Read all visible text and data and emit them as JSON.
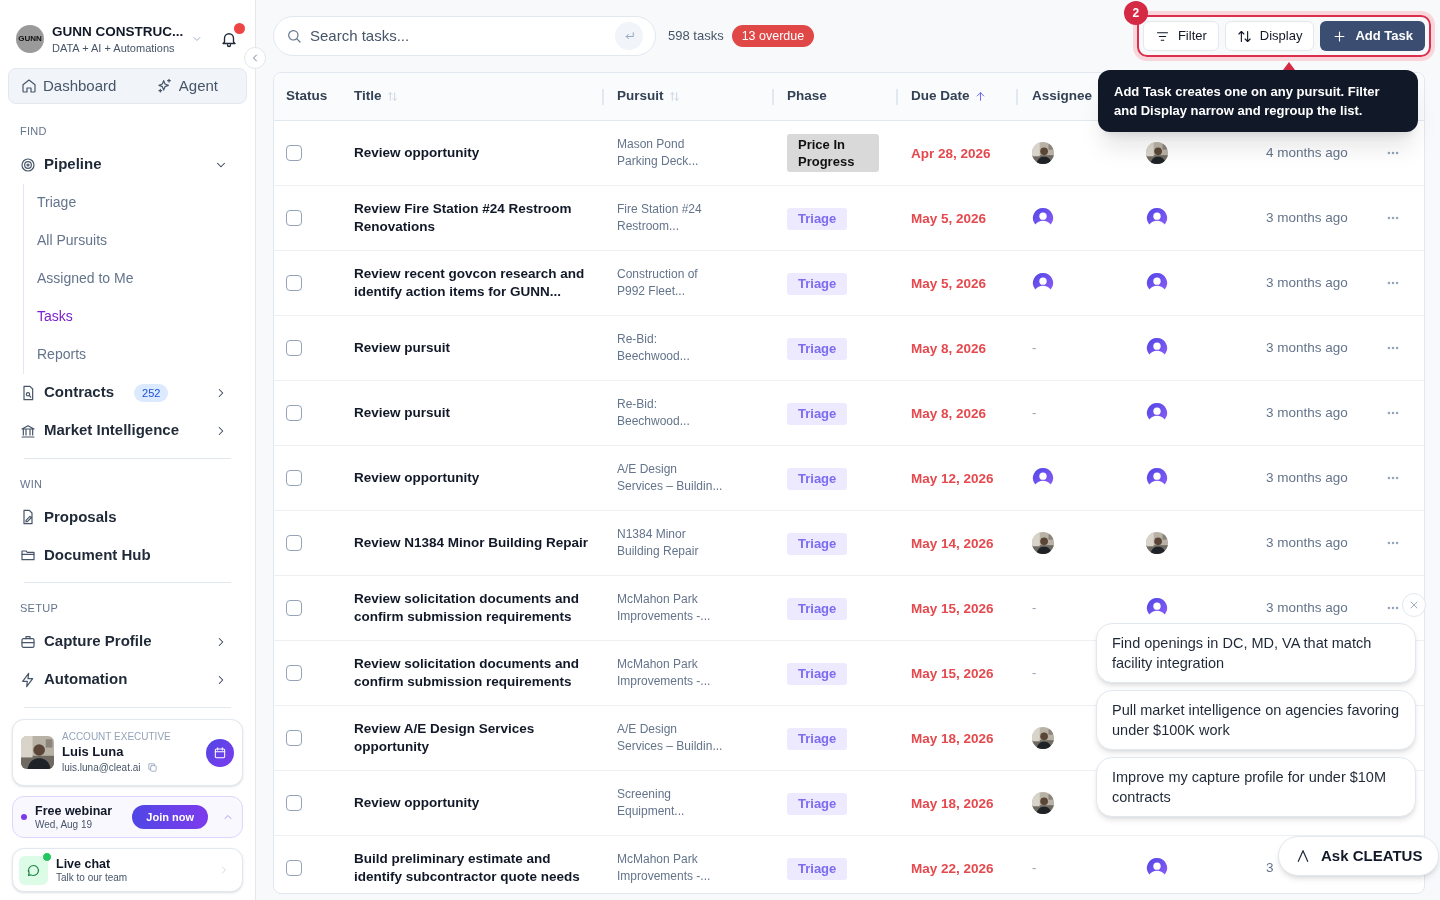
{
  "org": {
    "name": "GUNN CONSTRUC...",
    "subtitle": "DATA + AI + Automations",
    "logo": "GUNN",
    "has_notifications": true
  },
  "top_nav": [
    {
      "label": "Dashboard",
      "selected": false
    },
    {
      "label": "Agent",
      "selected": false
    }
  ],
  "sections": [
    {
      "heading": "FIND",
      "items": [
        {
          "label": "Pipeline",
          "expanded": true,
          "children": [
            {
              "label": "Triage",
              "selected": false
            },
            {
              "label": "All Pursuits",
              "selected": false
            },
            {
              "label": "Assigned to Me",
              "selected": false
            },
            {
              "label": "Tasks",
              "selected": true
            },
            {
              "label": "Reports",
              "selected": false
            }
          ]
        },
        {
          "label": "Contracts",
          "badge": "252",
          "expanded": false
        },
        {
          "label": "Market Intelligence",
          "expanded": false
        }
      ]
    },
    {
      "heading": "WIN",
      "items": [
        {
          "label": "Proposals"
        },
        {
          "label": "Document Hub"
        }
      ]
    },
    {
      "heading": "SETUP",
      "items": [
        {
          "label": "Capture Profile",
          "expanded": false
        },
        {
          "label": "Automation",
          "expanded": false
        }
      ]
    }
  ],
  "account": {
    "role": "ACCOUNT EXECUTIVE",
    "name": "Luis Luna",
    "email": "luis.luna@cleat.ai"
  },
  "webinar": {
    "title": "Free webinar",
    "date": "Wed, Aug 19",
    "button": "Join now"
  },
  "chat": {
    "title": "Live chat",
    "subtitle": "Talk to our team",
    "online": true
  },
  "search": {
    "placeholder": "Search tasks..."
  },
  "task_count": "598 tasks",
  "overdue": "13 overdue",
  "toolbar": {
    "step": "2",
    "buttons": [
      {
        "label": "Filter",
        "kind": "filter"
      },
      {
        "label": "Display",
        "kind": "display"
      },
      {
        "label": "Add Task",
        "kind": "add"
      }
    ]
  },
  "tooltip": "Add Task creates one on any pursuit. Filter and Display narrow and regroup the list.",
  "table": {
    "columns": [
      {
        "label": "Status"
      },
      {
        "label": "Title",
        "sortable": true
      },
      {
        "label": "Pursuit",
        "sortable": true
      },
      {
        "label": "Phase"
      },
      {
        "label": "Due Date",
        "sorted_ascending": true
      },
      {
        "label": "Assignee"
      }
    ],
    "rows": [
      {
        "checked": false,
        "title": "Review opportunity",
        "pursuit": "Mason Pond\nParking Deck...",
        "phase": {
          "label": "Price In Progress",
          "color": "#d9d9d9"
        },
        "due": "Apr 28, 2026",
        "updated": "4 months ago",
        "menu": true
      },
      {
        "checked": false,
        "title": "Review Fire Station #24 Restroom Renovations",
        "pursuit": "Fire Station #24\nRestroom...",
        "phase": {
          "label": "Triage",
          "color": "#ede9fe"
        },
        "due": "May 5, 2026",
        "assignee": {
          "kind": "user"
        },
        "owner": {
          "kind": "user"
        },
        "updated": "3 months ago",
        "menu": true
      },
      {
        "checked": false,
        "title": "Review recent govcon research and identify action items for GUNN...",
        "pursuit": "Construction of\nP992 Fleet...",
        "phase": {
          "label": "Triage",
          "color": "#ede9fe"
        },
        "due": "May 5, 2026",
        "assignee": {
          "kind": "user"
        },
        "owner": {
          "kind": "user"
        },
        "updated": "3 months ago",
        "menu": true
      },
      {
        "checked": false,
        "title": "Review pursuit",
        "pursuit": "Re-Bid:\nBeechwood...",
        "phase": {
          "label": "Triage",
          "color": "#ede9fe"
        },
        "due": "May 8, 2026",
        "assignee": {
          "kind": "empty",
          "text": "-"
        },
        "owner": {
          "kind": "user"
        },
        "updated": "3 months ago",
        "menu": true
      },
      {
        "checked": false,
        "title": "Review pursuit",
        "pursuit": "Re-Bid:\nBeechwood...",
        "phase": {
          "label": "Triage",
          "color": "#ede9fe"
        },
        "due": "May 8, 2026",
        "assignee": {
          "kind": "empty",
          "text": "-"
        },
        "owner": {
          "kind": "user"
        },
        "updated": "3 months ago",
        "menu": true
      },
      {
        "checked": false,
        "title": "Review opportunity",
        "pursuit": "A/E Design\nServices – Buildin...",
        "phase": {
          "label": "Triage",
          "color": "#ede9fe"
        },
        "due": "May 12, 2026",
        "assignee": {
          "kind": "user"
        },
        "owner": {
          "kind": "user"
        },
        "updated": "3 months ago",
        "menu": true
      },
      {
        "checked": false,
        "title": "Review N1384 Minor Building Repair",
        "pursuit": "N1384 Minor\nBuilding Repair",
        "phase": {
          "label": "Triage",
          "color": "#ede9fe"
        },
        "due": "May 14, 2026",
        "updated": "3 months ago",
        "menu": true
      },
      {
        "checked": false,
        "title": "Review solicitation documents and confirm submission requirements",
        "pursuit": "McMahon Park\nImprovements -...",
        "phase": {
          "label": "Triage",
          "color": "#ede9fe"
        },
        "due": "May 15, 2026",
        "assignee": {
          "kind": "empty",
          "text": "-"
        },
        "owner": {
          "kind": "user"
        },
        "updated": "3 months ago",
        "menu": true
      },
      {
        "checked": false,
        "title": "Review solicitation documents and confirm submission requirements",
        "pursuit": "McMahon Park\nImprovements -...",
        "phase": {
          "label": "Triage",
          "color": "#ede9fe"
        },
        "due": "May 15, 2026",
        "assignee": {
          "kind": "empty",
          "text": "-"
        }
      },
      {
        "checked": false,
        "title": "Review A/E Design Services opportunity",
        "pursuit": "A/E Design\nServices – Buildin...",
        "phase": {
          "label": "Triage",
          "color": "#ede9fe"
        },
        "due": "May 18, 2026"
      },
      {
        "checked": false,
        "title": "Review opportunity",
        "pursuit": "Screening\nEquipment...",
        "phase": {
          "label": "Triage",
          "color": "#ede9fe"
        },
        "due": "May 18, 2026"
      },
      {
        "checked": false,
        "title": "Build preliminary estimate and identify subcontractor quote needs",
        "pursuit": "McMahon Park\nImprovements -...",
        "phase": {
          "label": "Triage",
          "color": "#ede9fe"
        },
        "due": "May 22, 2026",
        "assignee": {
          "kind": "empty",
          "text": "-"
        },
        "owner": {
          "kind": "user"
        },
        "updated": "3"
      }
    ]
  },
  "suggestions": [
    "Find openings in DC, MD, VA that match facility integration",
    "Pull market intelligence on agencies favoring under $100K work",
    "Improve my capture profile for under $10M contracts"
  ],
  "ask_button": "Ask CLEATUS"
}
